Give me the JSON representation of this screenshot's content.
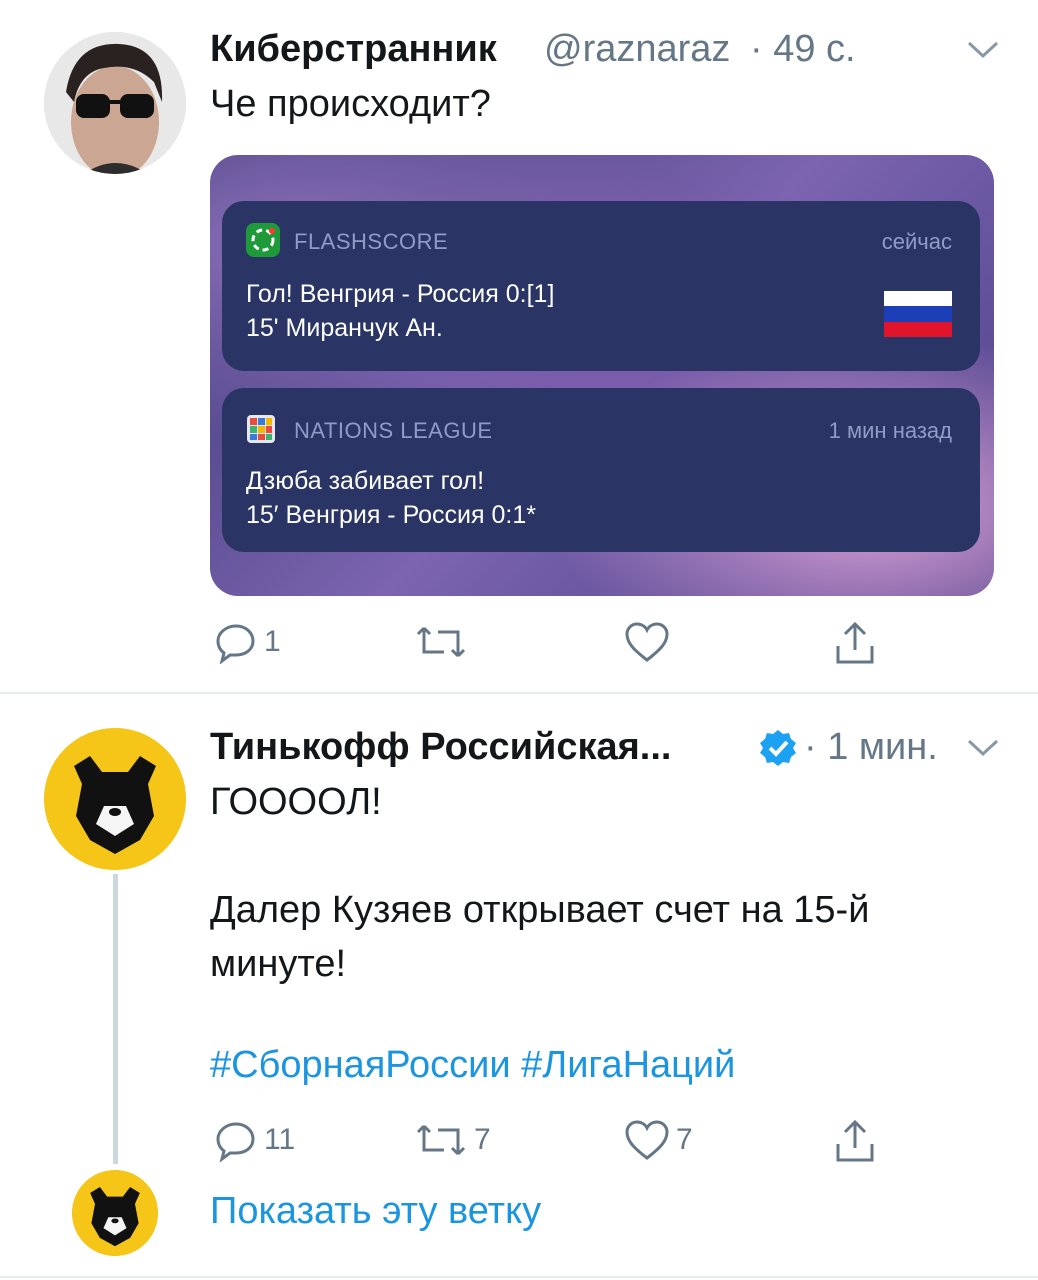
{
  "tweet1": {
    "author": "Киберстранник",
    "handle": "@raznaraz",
    "time": "· 49 с.",
    "text": "Че происходит?",
    "card": {
      "notif1": {
        "app": "FLASHSCORE",
        "time": "сейчас",
        "line1": "Гол! Венгрия - Россия 0:[1]",
        "line2": "15' Миранчук Ан."
      },
      "notif2": {
        "app": "NATIONS LEAGUE",
        "time": "1 мин назад",
        "line1": "Дзюба забивает гол!",
        "line2": "15′ Венгрия - Россия 0:1*"
      }
    },
    "actions": {
      "reply_count": "1",
      "retweet_count": "",
      "like_count": ""
    }
  },
  "tweet2": {
    "author": "Тинькофф Российская...",
    "time": "· 1 мин.",
    "text_line1": "ГООООЛ!",
    "text_line2": "Далер Кузяев открывает счет на 15-й",
    "text_line3": "минуте!",
    "hashtags": "#СборнаяРоссии #ЛигаНаций",
    "actions": {
      "reply_count": "11",
      "retweet_count": "7",
      "like_count": "7"
    }
  },
  "thread": {
    "show_thread": "Показать эту ветку"
  },
  "colors": {
    "link": "#1b95e0",
    "muted": "#657786",
    "rpl_yellow": "#f5c518",
    "notif_bg": "#2a3565"
  }
}
